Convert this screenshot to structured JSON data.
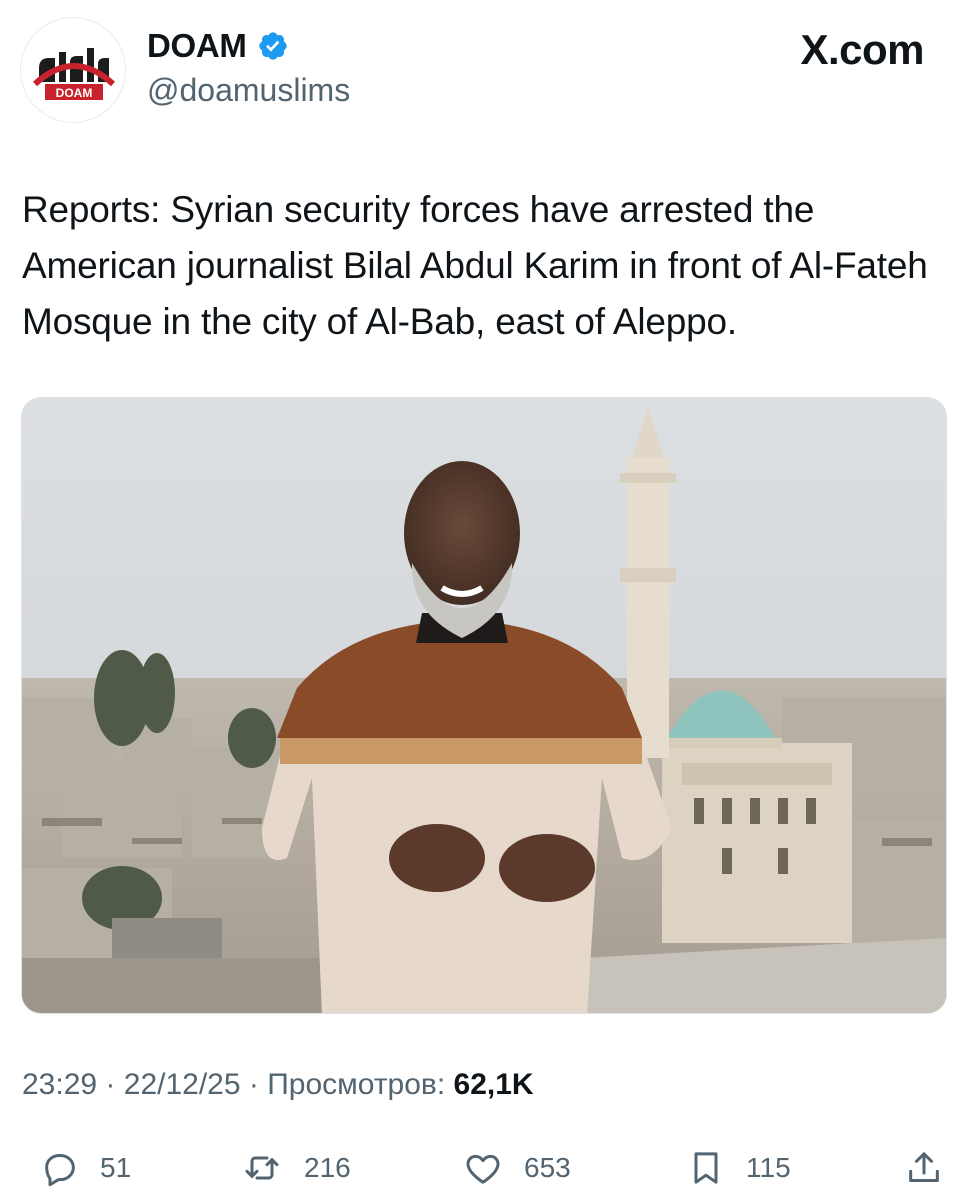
{
  "account": {
    "logo_text": "DOAM",
    "display_name": "DOAM",
    "verified": true,
    "handle": "@doamuslims"
  },
  "brand": "X.com",
  "tweet": {
    "text": "Reports: Syrian security forces have arrested the American journalist Bilal Abdul Karim in front of Al-Fateh Mosque in the city of Al-Bab, east of Aleppo."
  },
  "meta": {
    "time": "23:29",
    "date": "22/12/25",
    "views_label": "Просмотров:",
    "views_count": "62,1K",
    "separator": "·"
  },
  "actions": {
    "replies": "51",
    "reposts": "216",
    "likes": "653",
    "bookmarks": "115"
  },
  "icons": {
    "verified": "verified-badge-icon",
    "reply": "speech-bubble-icon",
    "repost": "repost-arrows-icon",
    "like": "heart-icon",
    "bookmark": "bookmark-icon",
    "share": "share-upload-icon"
  },
  "colors": {
    "text": "#0f1419",
    "secondary": "#536471",
    "verified_blue": "#1d9bf0",
    "logo_red": "#c8232c"
  }
}
